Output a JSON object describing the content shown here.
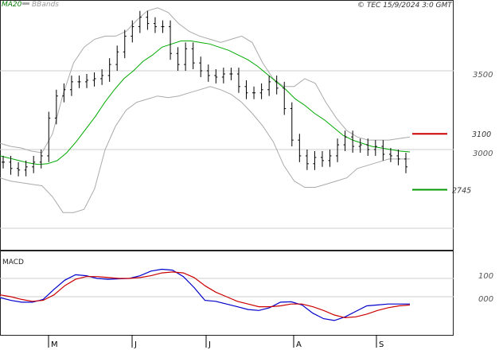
{
  "header": {
    "legend_ma": "MA20",
    "legend_bb": "BBands",
    "watermark": "© TEC 15/9/2024 3:0 GMT"
  },
  "macd_label": "MACD",
  "chart_data": [
    {
      "type": "line",
      "title": "",
      "yticks": [
        "3500",
        "3000"
      ],
      "ylim": [
        2000,
        4000
      ],
      "levels": [
        {
          "name": "resistance",
          "label": "3100",
          "value": 3100,
          "color": "#cc0000"
        },
        {
          "name": "support",
          "label": "2745",
          "value": 2745,
          "color": "#009900"
        }
      ],
      "x_month_labels": [
        "M",
        "J",
        "J",
        "A",
        "S"
      ],
      "series": [
        {
          "name": "MA20",
          "color": "#00aa00",
          "values": [
            2960,
            2945,
            2930,
            2915,
            2905,
            2910,
            2930,
            2980,
            3050,
            3130,
            3210,
            3300,
            3380,
            3450,
            3500,
            3560,
            3600,
            3650,
            3670,
            3690,
            3690,
            3680,
            3670,
            3650,
            3630,
            3600,
            3570,
            3530,
            3480,
            3430,
            3380,
            3320,
            3280,
            3230,
            3190,
            3140,
            3090,
            3060,
            3040,
            3020,
            3010,
            3000,
            2990,
            2985
          ]
        },
        {
          "name": "BBands-upper",
          "color": "#aaaaaa",
          "values": [
            3040,
            3020,
            3010,
            2990,
            2980,
            3100,
            3350,
            3550,
            3650,
            3700,
            3720,
            3720,
            3750,
            3820,
            3880,
            3900,
            3870,
            3800,
            3750,
            3720,
            3700,
            3680,
            3700,
            3720,
            3680,
            3550,
            3450,
            3400,
            3400,
            3450,
            3420,
            3300,
            3200,
            3120,
            3080,
            3060,
            3060,
            3060,
            3070,
            3080
          ]
        },
        {
          "name": "BBands-lower",
          "color": "#aaaaaa",
          "values": [
            2820,
            2800,
            2790,
            2780,
            2770,
            2700,
            2600,
            2600,
            2620,
            2750,
            3000,
            3150,
            3250,
            3300,
            3320,
            3340,
            3330,
            3340,
            3360,
            3380,
            3400,
            3380,
            3350,
            3300,
            3230,
            3150,
            3050,
            2900,
            2800,
            2760,
            2760,
            2780,
            2800,
            2820,
            2880,
            2900,
            2920,
            2940,
            2940,
            2940
          ]
        }
      ],
      "ohlc_close": [
        2920,
        2880,
        2870,
        2890,
        2920,
        2960,
        3200,
        3340,
        3380,
        3430,
        3430,
        3440,
        3450,
        3470,
        3540,
        3620,
        3720,
        3780,
        3840,
        3800,
        3780,
        3780,
        3610,
        3540,
        3640,
        3550,
        3500,
        3470,
        3460,
        3480,
        3480,
        3400,
        3360,
        3360,
        3380,
        3430,
        3390,
        3260,
        3060,
        2960,
        2910,
        2950,
        2930,
        2960,
        3030,
        3080,
        3020,
        3030,
        3000,
        3020,
        2970,
        2960,
        2940,
        2890
      ]
    },
    {
      "type": "line",
      "title": "MACD",
      "yticks": [
        "100",
        "000"
      ],
      "series": [
        {
          "name": "MACD",
          "color": "#0000cc",
          "values": [
            -5,
            -20,
            -30,
            -30,
            -15,
            40,
            90,
            120,
            115,
            100,
            95,
            98,
            100,
            115,
            140,
            150,
            145,
            110,
            50,
            -20,
            -25,
            -40,
            -55,
            -70,
            -75,
            -60,
            -30,
            -28,
            -45,
            -90,
            -120,
            -130,
            -110,
            -80,
            -50,
            -45,
            -40,
            -40,
            -40
          ]
        },
        {
          "name": "Signal",
          "color": "#cc0000",
          "values": [
            10,
            0,
            -15,
            -25,
            -20,
            10,
            60,
            95,
            110,
            110,
            105,
            100,
            100,
            105,
            115,
            130,
            135,
            130,
            105,
            60,
            25,
            0,
            -25,
            -40,
            -55,
            -55,
            -50,
            -40,
            -40,
            -55,
            -75,
            -100,
            -115,
            -110,
            -95,
            -75,
            -60,
            -50,
            -45
          ]
        }
      ]
    }
  ]
}
